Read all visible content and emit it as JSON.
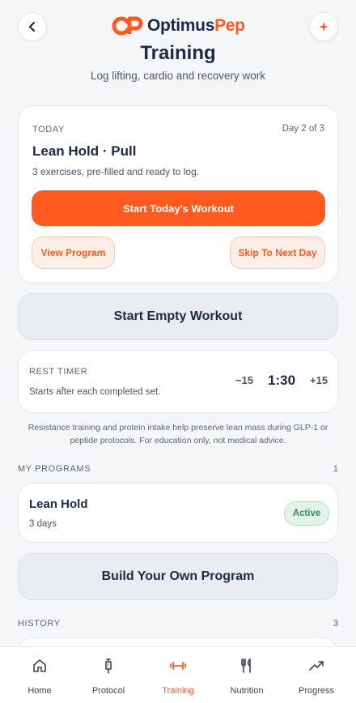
{
  "header": {
    "logo_part1": "Optimus",
    "logo_part2": "Pep",
    "title": "Training",
    "subtitle": "Log lifting, cardio and recovery work"
  },
  "today": {
    "label": "TODAY",
    "day_count": "Day 2 of 3",
    "workout_name": "Lean Hold · Pull",
    "description": "3 exercises, pre-filled and ready to log.",
    "start_label": "Start Today's Workout",
    "view_program_label": "View Program",
    "skip_label": "Skip To Next Day"
  },
  "empty_workout_label": "Start Empty Workout",
  "rest_timer": {
    "label": "REST TIMER",
    "description": "Starts after each completed set.",
    "minus_label": "−15",
    "value": "1:30",
    "plus_label": "+15"
  },
  "disclaimer": "Resistance training and protein intake help preserve lean mass during GLP-1 or peptide protocols. For education only, not medical advice.",
  "programs": {
    "label": "MY PROGRAMS",
    "count": "1",
    "items": [
      {
        "name": "Lean Hold",
        "days": "3 days",
        "status": "Active"
      }
    ]
  },
  "build_program_label": "Build Your Own Program",
  "history": {
    "label": "HISTORY",
    "count": "3"
  },
  "tabs": [
    {
      "label": "Home",
      "icon": "home-icon"
    },
    {
      "label": "Protocol",
      "icon": "syringe-icon"
    },
    {
      "label": "Training",
      "icon": "dumbbell-icon"
    },
    {
      "label": "Nutrition",
      "icon": "utensils-icon"
    },
    {
      "label": "Progress",
      "icon": "trend-up-icon"
    }
  ],
  "colors": {
    "accent": "#ff5a1f",
    "navy": "#1c2a44",
    "active_green": "#2c8a55"
  }
}
